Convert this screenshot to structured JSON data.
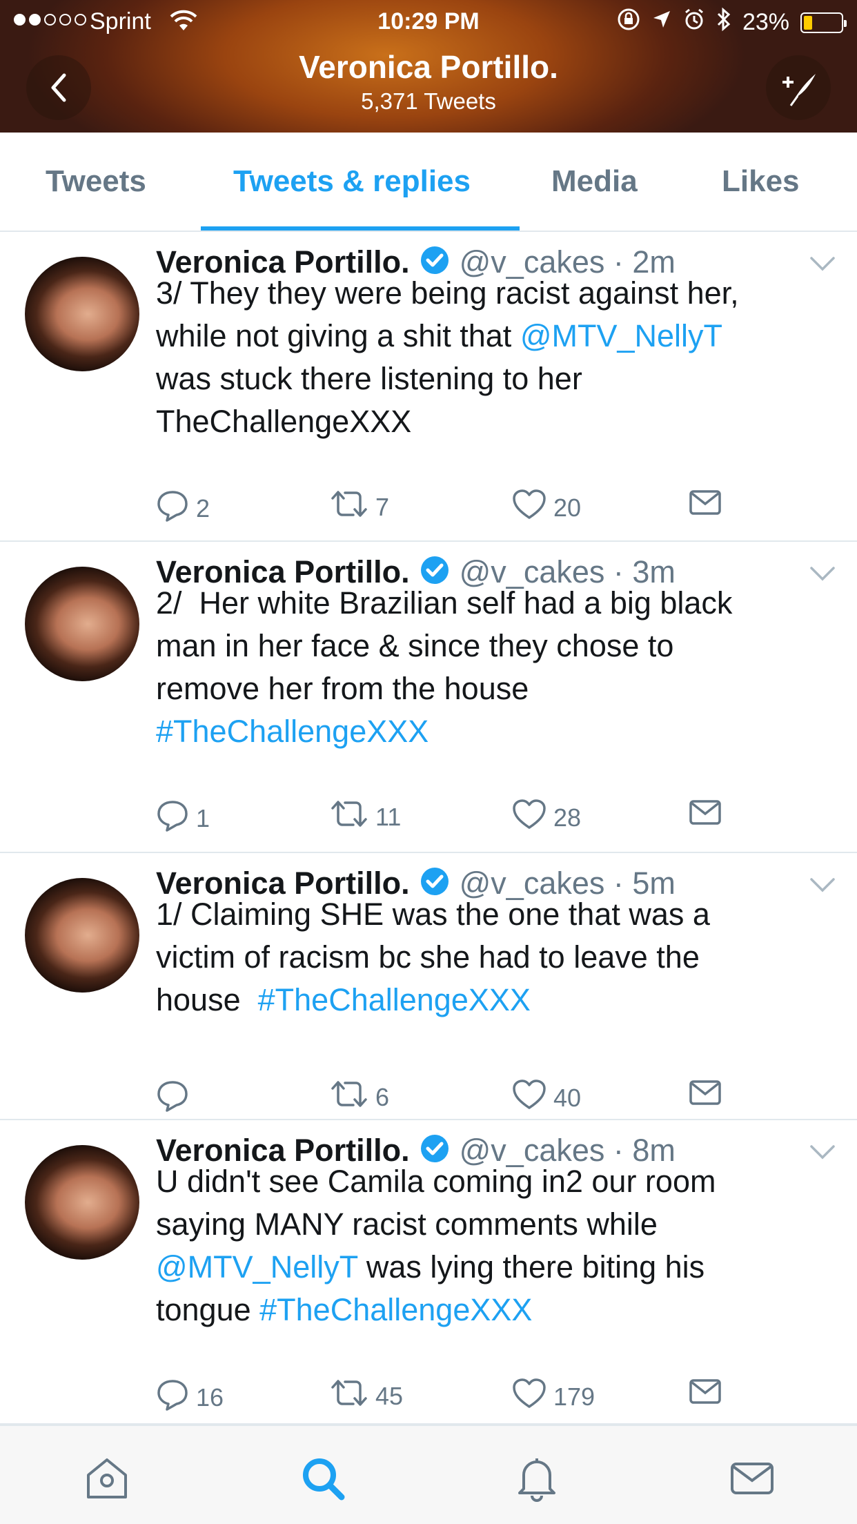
{
  "status_bar": {
    "carrier": "Sprint",
    "time": "10:29 PM",
    "battery_percent": "23%",
    "battery_level": 0.23,
    "signal_bars_filled": 2,
    "signal_bars_total": 5
  },
  "header": {
    "profile_name": "Veronica Portillo.",
    "tweet_count": "5,371 Tweets"
  },
  "tabs": [
    {
      "label": "Tweets",
      "active": false
    },
    {
      "label": "Tweets & replies",
      "active": true
    },
    {
      "label": "Media",
      "active": false
    },
    {
      "label": "Likes",
      "active": false
    }
  ],
  "tweets": [
    {
      "name": "Veronica Portillo.",
      "handle": "@v_cakes",
      "time": "2m",
      "text_lines": [
        [
          {
            "t": "3/ They they were being racist against her,"
          }
        ],
        [
          {
            "t": "while not giving a shit that "
          },
          {
            "t": "@MTV_NellyT",
            "link": true
          }
        ],
        [
          {
            "t": "was stuck there listening to her"
          }
        ],
        [
          {
            "t": "TheChallengeXXX"
          }
        ]
      ],
      "replies": "2",
      "retweets": "7",
      "likes": "20"
    },
    {
      "name": "Veronica Portillo.",
      "handle": "@v_cakes",
      "time": "3m",
      "text_lines": [
        [
          {
            "t": "2/  Her white Brazilian self had a big black"
          }
        ],
        [
          {
            "t": "man in her face & since they chose to"
          }
        ],
        [
          {
            "t": "remove her from the house"
          }
        ],
        [
          {
            "t": "#TheChallengeXXX",
            "link": true
          }
        ]
      ],
      "replies": "1",
      "retweets": "11",
      "likes": "28"
    },
    {
      "name": "Veronica Portillo.",
      "handle": "@v_cakes",
      "time": "5m",
      "text_lines": [
        [
          {
            "t": "1/ Claiming SHE was the one that was a"
          }
        ],
        [
          {
            "t": "victim of racism bc she had to leave the"
          }
        ],
        [
          {
            "t": "house  "
          },
          {
            "t": "#TheChallengeXXX",
            "link": true
          }
        ]
      ],
      "replies": "",
      "retweets": "6",
      "likes": "40"
    },
    {
      "name": "Veronica Portillo.",
      "handle": "@v_cakes",
      "time": "8m",
      "text_lines": [
        [
          {
            "t": "U didn't see Camila coming in2 our room"
          }
        ],
        [
          {
            "t": "saying MANY racist comments while"
          }
        ],
        [
          {
            "t": "@MTV_NellyT",
            "link": true
          },
          {
            "t": " was lying there biting his"
          }
        ],
        [
          {
            "t": "tongue "
          },
          {
            "t": "#TheChallengeXXX",
            "link": true
          }
        ]
      ],
      "replies": "16",
      "retweets": "45",
      "likes": "179"
    }
  ],
  "bottom_tabs": [
    {
      "icon": "home-icon",
      "active": false
    },
    {
      "icon": "search-icon",
      "active": true
    },
    {
      "icon": "notifications-icon",
      "active": false
    },
    {
      "icon": "messages-icon",
      "active": false
    }
  ],
  "colors": {
    "accent": "#1da1f2",
    "secondary_text": "#657786",
    "divider": "#e1e8ed",
    "header_dark": "#5a2310",
    "header_light": "#c9701a"
  }
}
